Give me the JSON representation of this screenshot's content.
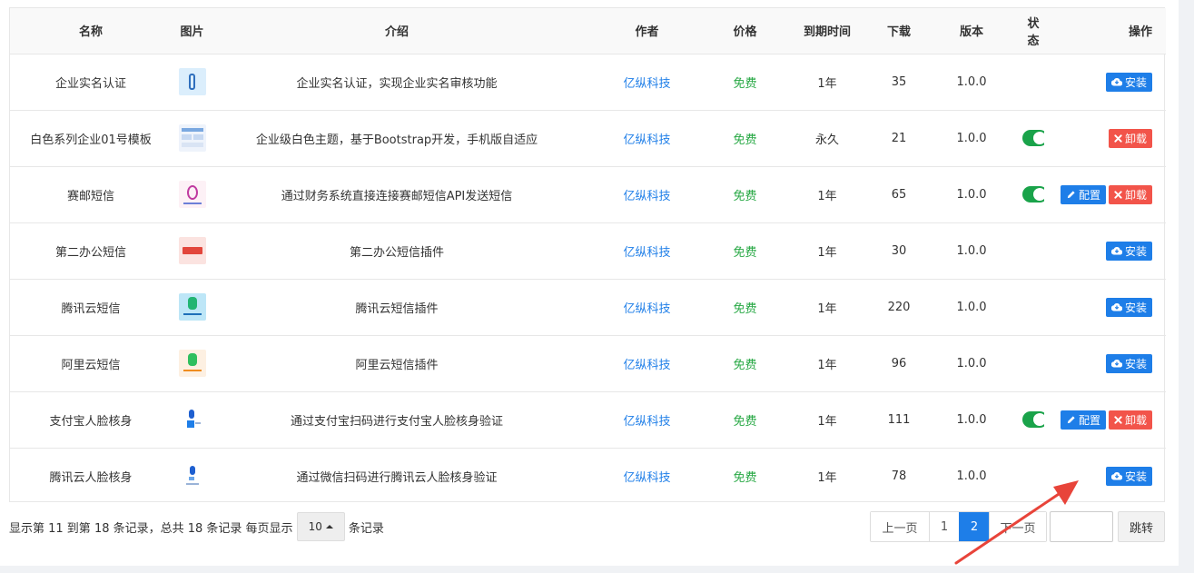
{
  "table": {
    "headers": {
      "name": "名称",
      "image": "图片",
      "intro": "介绍",
      "author": "作者",
      "price": "价格",
      "expire": "到期时间",
      "downloads": "下载",
      "version": "版本",
      "status": "状态",
      "actions": "操作"
    },
    "rows": [
      {
        "name": "企业实名认证",
        "intro": "企业实名认证，实现企业实名审核功能",
        "author": "亿纵科技",
        "price": "免费",
        "expire": "1年",
        "downloads": "35",
        "version": "1.0.0",
        "status_on": false,
        "installed": false
      },
      {
        "name": "白色系列企业01号模板",
        "intro": "企业级白色主题，基于Bootstrap开发，手机版自适应",
        "author": "亿纵科技",
        "price": "免费",
        "expire": "永久",
        "downloads": "21",
        "version": "1.0.0",
        "status_on": true,
        "installed": true,
        "configurable": false
      },
      {
        "name": "赛邮短信",
        "intro": "通过财务系统直接连接赛邮短信API发送短信",
        "author": "亿纵科技",
        "price": "免费",
        "expire": "1年",
        "downloads": "65",
        "version": "1.0.0",
        "status_on": true,
        "installed": true,
        "configurable": true
      },
      {
        "name": "第二办公短信",
        "intro": "第二办公短信插件",
        "author": "亿纵科技",
        "price": "免费",
        "expire": "1年",
        "downloads": "30",
        "version": "1.0.0",
        "status_on": false,
        "installed": false
      },
      {
        "name": "腾讯云短信",
        "intro": "腾讯云短信插件",
        "author": "亿纵科技",
        "price": "免费",
        "expire": "1年",
        "downloads": "220",
        "version": "1.0.0",
        "status_on": false,
        "installed": false
      },
      {
        "name": "阿里云短信",
        "intro": "阿里云短信插件",
        "author": "亿纵科技",
        "price": "免费",
        "expire": "1年",
        "downloads": "96",
        "version": "1.0.0",
        "status_on": false,
        "installed": false
      },
      {
        "name": "支付宝人脸核身",
        "intro": "通过支付宝扫码进行支付宝人脸核身验证",
        "author": "亿纵科技",
        "price": "免费",
        "expire": "1年",
        "downloads": "111",
        "version": "1.0.0",
        "status_on": true,
        "installed": true,
        "configurable": true
      },
      {
        "name": "腾讯云人脸核身",
        "intro": "通过微信扫码进行腾讯云人脸核身验证",
        "author": "亿纵科技",
        "price": "免费",
        "expire": "1年",
        "downloads": "78",
        "version": "1.0.0",
        "status_on": false,
        "installed": false
      }
    ],
    "thumb_icons": [
      "verify-icon",
      "template-icon",
      "submail-icon",
      "sms-icon",
      "tencent-sms-icon",
      "aliyun-sms-icon",
      "alipay-face-icon",
      "tencent-face-icon"
    ]
  },
  "buttons": {
    "install": "安装",
    "uninstall": "卸载",
    "config": "配置"
  },
  "footer": {
    "info_prefix": "显示第 11 到第 18 条记录，总共 18 条记录 每页显示",
    "page_size": "10",
    "info_suffix": "条记录"
  },
  "pagination": {
    "prev": "上一页",
    "pages": [
      "1",
      "2"
    ],
    "active_page": "2",
    "next": "下一页",
    "jump_label": "跳转",
    "jump_value": ""
  },
  "colors": {
    "primary": "#1e7ee8",
    "danger": "#f2544a",
    "success": "#27a844",
    "toggle_on": "#1aa34a",
    "annotation_arrow": "#e8443a"
  }
}
